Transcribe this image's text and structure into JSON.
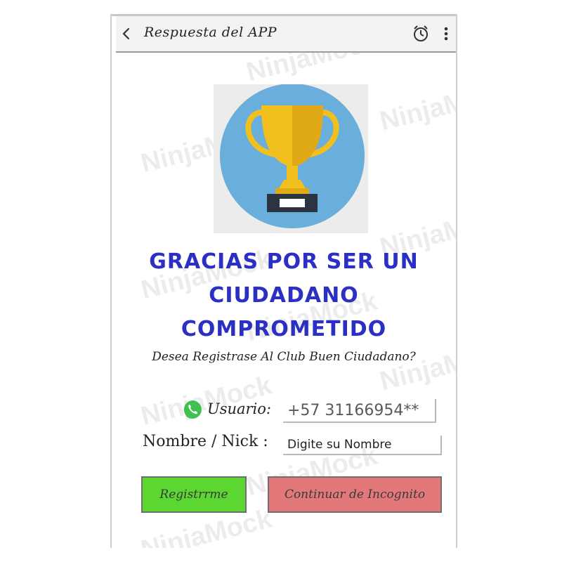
{
  "appbar": {
    "title": "Respuesta del APP",
    "back_icon": "back-arrow-icon",
    "alarm_icon": "alarm-clock-icon",
    "menu_icon": "more-vertical-icon"
  },
  "watermark": "NinjaMock",
  "hero": {
    "icon": "trophy-icon",
    "colors": {
      "circle": "#6aaedb",
      "cup": "#f2c01e",
      "base": "#2b3440"
    }
  },
  "headline": {
    "line1": "GRACIAS POR SER UN",
    "line2": "CIUDADANO",
    "line3": "COMPROMETIDO"
  },
  "question": "Desea Registrase Al Club Buen Ciudadano?",
  "form": {
    "user_label": "Usuario:",
    "user_value": "+57 31166954**",
    "nick_label": "Nombre / Nick :",
    "nick_value": "Digite su Nombre"
  },
  "buttons": {
    "register": "Registrrme",
    "incognito": "Continuar de Incognito"
  },
  "colors": {
    "headline": "#2b2fc4",
    "register_bg": "#5cd630",
    "incognito_bg": "#e3787a"
  }
}
